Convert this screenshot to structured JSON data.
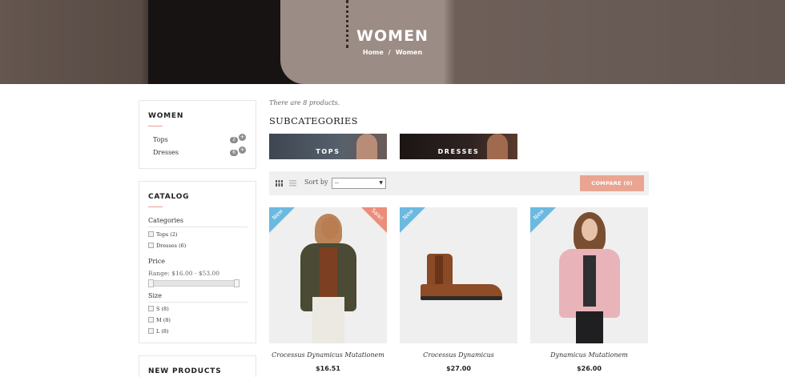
{
  "hero": {
    "title": "WOMEN",
    "breadcrumb": {
      "home": "Home",
      "separator": "/",
      "current": "Women"
    }
  },
  "sidebar": {
    "women": {
      "title": "WOMEN",
      "items": [
        {
          "label": "Tops",
          "count": "2"
        },
        {
          "label": "Dresses",
          "count": "6"
        }
      ]
    },
    "catalog": {
      "title": "CATALOG",
      "categories_label": "Categories",
      "categories": [
        "Tops (2)",
        "Dresses (6)"
      ],
      "price_label": "Price",
      "price_range": "Range: $16.00 - $53.00",
      "size_label": "Size",
      "sizes": [
        "S (8)",
        "M (8)",
        "L (8)"
      ]
    },
    "new_products": {
      "title": "NEW PRODUCTS"
    }
  },
  "main": {
    "count_text": "There are 8 products.",
    "subcategories_title": "SUBCATEGORIES",
    "subcategories": [
      "TOPS",
      "DRESSES"
    ],
    "toolbar": {
      "sort_label": "Sort by",
      "sort_value": "--",
      "compare_label": "COMPARE (0)"
    },
    "products": [
      {
        "name": "Crocessus Dynamicus Mutationem",
        "price": "$16.51",
        "new_label": "New",
        "sale_label": "Sale!"
      },
      {
        "name": "Crocessus Dynamicus",
        "price": "$27.00",
        "new_label": "New"
      },
      {
        "name": "Dynamicus Mutationem",
        "price": "$26.00",
        "new_label": "New"
      }
    ]
  },
  "colors": {
    "accent": "#eaa592",
    "new_ribbon": "#6cb9e0",
    "sale_ribbon": "#eb8e79",
    "toolbar_bg": "#f0f0f0"
  }
}
